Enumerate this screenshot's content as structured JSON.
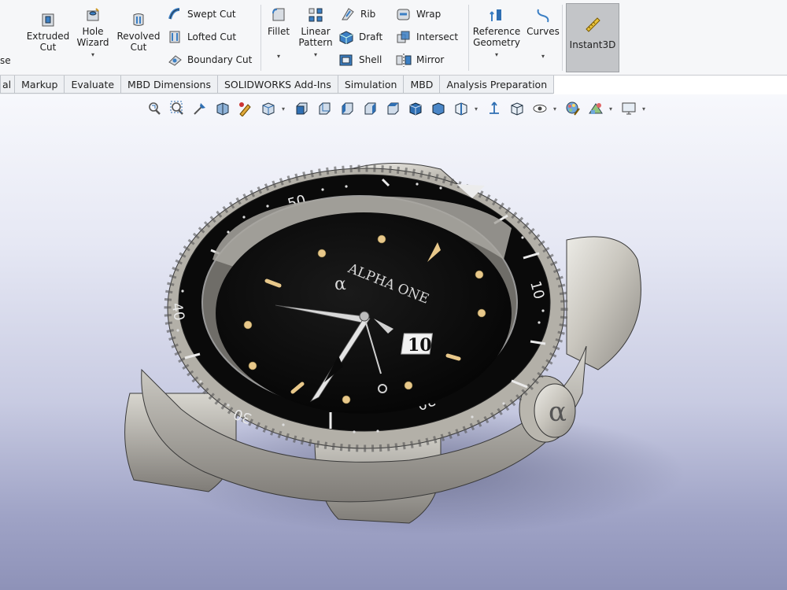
{
  "ribbon": {
    "cut_left": "se",
    "extruded_cut": "Extruded\nCut",
    "hole_wizard": "Hole\nWizard",
    "revolved_cut": "Revolved\nCut",
    "swept_cut": "Swept Cut",
    "lofted_cut": "Lofted Cut",
    "boundary_cut": "Boundary Cut",
    "fillet": "Fillet",
    "linear_pattern": "Linear\nPattern",
    "rib": "Rib",
    "draft": "Draft",
    "shell": "Shell",
    "wrap": "Wrap",
    "intersect": "Intersect",
    "mirror": "Mirror",
    "reference_geometry": "Reference\nGeometry",
    "curves": "Curves",
    "instant3d": "Instant3D",
    "caret": "▾"
  },
  "tabs": [
    {
      "label": "al"
    },
    {
      "label": "Markup"
    },
    {
      "label": "Evaluate"
    },
    {
      "label": "MBD Dimensions"
    },
    {
      "label": "SOLIDWORKS Add-Ins"
    },
    {
      "label": "Simulation"
    },
    {
      "label": "MBD"
    },
    {
      "label": "Analysis Preparation"
    }
  ],
  "headsup_toolbar": {
    "icons": [
      "zoom-to-fit-icon",
      "zoom-area-icon",
      "previous-view-icon",
      "section-view-icon",
      "dynamic-annotation-icon",
      "view-orientation-icon",
      "front-view-icon",
      "back-view-icon",
      "left-view-icon",
      "right-view-icon",
      "top-view-icon",
      "isometric-view-icon",
      "display-style-icon",
      "hide-show-icon",
      "view-selector-icon",
      "rotate-icon",
      "hide-items-icon",
      "edit-appearance-icon",
      "apply-scene-icon",
      "view-settings-icon"
    ]
  },
  "watch": {
    "brand": "ALPHA ONE",
    "logo": "α",
    "date": "10",
    "bezel_50": "50",
    "bezel_40": "40",
    "bezel_30": "30",
    "bezel_20": "20",
    "bezel_10": "10"
  },
  "colors": {
    "ribbon_bg": "#f6f7f9",
    "tab_bg": "#eef0f3",
    "viewport_top": "#f7f8fc",
    "viewport_bottom": "#8e92b8",
    "steel": "#c9c6be",
    "dial": "#050505",
    "lume": "#e8c88a",
    "icon_blue": "#2f6fb3"
  }
}
